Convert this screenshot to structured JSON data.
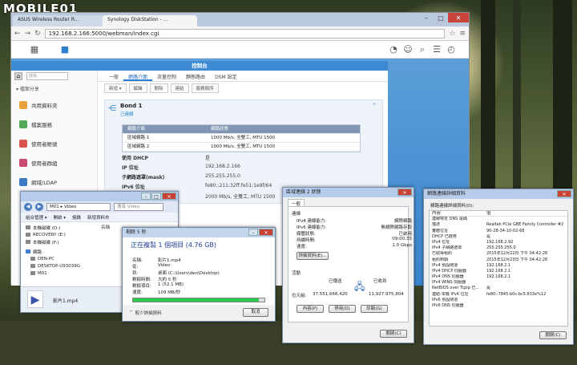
{
  "brand": "MOBILE01",
  "browser": {
    "tabs": [
      "ASUS Wireless Router R...",
      "Synology DiskStation - ..."
    ],
    "url": "192.168.2.166:5000/webman/index.cgi"
  },
  "control_panel": {
    "title": "控制台",
    "search_placeholder": "搜尋",
    "side_section": "▾ 檔案分享",
    "side_items": [
      "共用資料夾",
      "檔案服務",
      "使用者帳號",
      "使用者群組",
      "網域/LDAP"
    ],
    "tabs": [
      "一般",
      "網路介面",
      "流量控制",
      "靜態路由",
      "DSM 設定"
    ],
    "toolbar": [
      "新增 ▾",
      "編輯",
      "刪除",
      "連結",
      "服務順序"
    ],
    "bond_name": "Bond 1",
    "bond_status": "已連線",
    "table_header": [
      "網路介面",
      "網路狀態"
    ],
    "table_rows": [
      [
        "區域網路 1",
        "1000 Mb/s, 全雙工, MTU 1500"
      ],
      [
        "區域網路 2",
        "1000 Mb/s, 全雙工, MTU 1500"
      ]
    ],
    "fields": [
      {
        "k": "使用 DHCP",
        "v": "是"
      },
      {
        "k": "IP 位址",
        "v": "192.168.2.166"
      },
      {
        "k": "子網路遮罩(mask)",
        "v": "255.255.255.0"
      },
      {
        "k": "IPv6 位址",
        "v": "fe80::211:32ff:fe51:1e9f/64"
      },
      {
        "k": "網路狀態",
        "v": "2000 Mb/s, 全雙工, MTU 1500"
      }
    ]
  },
  "explorer": {
    "path": "M01 ▸ Video",
    "search": "搜尋 Video",
    "toolbar": [
      "組合管理 ▾",
      "開啟 ▾",
      "燒錄",
      "新增資料夾"
    ],
    "tree": [
      "本機磁碟 (D:)",
      "RECOVERY (E:)",
      "本機磁碟 (F:)",
      "網路",
      "DEN-PC",
      "DESKTOP-U93039G",
      "M01"
    ],
    "column": "名稱",
    "file": "影片1.mp4"
  },
  "copy_dialog": {
    "title": "剩餘 5 秒",
    "heading": "正在複製 1 個項目 (4.76 GB)",
    "fields": [
      {
        "k": "名稱:",
        "v": "影片1.mp4"
      },
      {
        "k": "從:",
        "v": "Video"
      },
      {
        "k": "到:",
        "v": "桌面 (C:\\Users\\den\\Desktop)"
      },
      {
        "k": "剩餘時間:",
        "v": "大約 5 秒"
      },
      {
        "k": "剩餘項目:",
        "v": "1 (52.1 MB)"
      },
      {
        "k": "速度:",
        "v": "109 MB/秒"
      }
    ],
    "progress": 0.96,
    "less_info": "較少詳細資料",
    "cancel": "取消"
  },
  "nic_status": {
    "title": "區域連線 2 狀態",
    "tab": "一般",
    "conn_label": "連線",
    "rows": [
      {
        "k": "IPv4 連線能力:",
        "v": "網際網路"
      },
      {
        "k": "IPv6 連線能力:",
        "v": "無網際網路存取"
      },
      {
        "k": "媒體狀態:",
        "v": "已啟用"
      },
      {
        "k": "持續時間:",
        "v": "09:00:35"
      },
      {
        "k": "速度:",
        "v": "1.0 Gbps"
      }
    ],
    "details_btn": "詳細資料(E)...",
    "activity_label": "活動",
    "sent": "已傳送",
    "received": "已收到",
    "bytes_label": "位元組:",
    "bytes_sent": "37,551,666,420",
    "bytes_received": "11,927,975,804",
    "buttons": [
      "內容(P)",
      "停用(D)",
      "診斷(G)"
    ],
    "close": "關閉(C)"
  },
  "net_details": {
    "title": "網路連線詳細資料",
    "subtitle": "網路連線詳細資料(D):",
    "col_prop": "內容",
    "col_val": "值",
    "rows": [
      [
        "連線特定 DNS 尾碼",
        ""
      ],
      [
        "描述",
        "Realtek PCIe GBE Family Controller #2"
      ],
      [
        "實體位址",
        "90-2B-34-10-02-68"
      ],
      [
        "DHCP 已啟用",
        "是"
      ],
      [
        "IPv4 位址",
        "192.168.2.92"
      ],
      [
        "IPv4 子網路遮罩",
        "255.255.255.0"
      ],
      [
        "已取得租約",
        "2015年12月22日 下午 04:42:28"
      ],
      [
        "租約到期",
        "2015年12月23日 下午 04:42:28"
      ],
      [
        "IPv4 預設閘道",
        "192.168.2.1"
      ],
      [
        "IPv4 DHCP 伺服器",
        "192.168.2.1"
      ],
      [
        "IPv4 DNS 伺服器",
        "192.168.2.1"
      ],
      [
        "IPv4 WINS 伺服器",
        ""
      ],
      [
        "NetBIOS over Tcpip 已...",
        "是"
      ],
      [
        "連結-本機 IPv6 位址",
        "fe80::7845:b0c:bc5:833e%12"
      ],
      [
        "IPv6 預設閘道",
        ""
      ],
      [
        "IPv6 DNS 伺服器",
        ""
      ]
    ],
    "close": "關閉(C)"
  }
}
